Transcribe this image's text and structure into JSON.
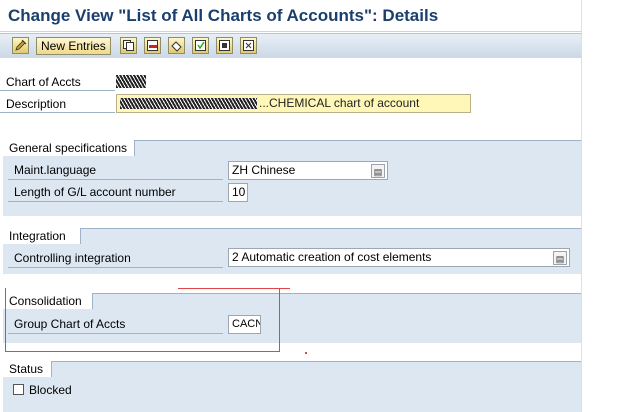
{
  "title": "Change View \"List of All Charts of Accounts\": Details",
  "toolbar": {
    "new_entries_label": "New Entries",
    "icons": [
      "edit-pencil-icon",
      "copy-icon",
      "delete-icon",
      "undo-icon",
      "select-all-icon",
      "select-block-icon",
      "deselect-all-icon"
    ]
  },
  "header": {
    "chart_of_accts_label": "Chart of Accts",
    "description_label": "Description",
    "description_value": "...CHEMICAL chart of account"
  },
  "general": {
    "title": "General specifications",
    "maint_language_label": "Maint.language",
    "maint_language_value": "ZH Chinese",
    "length_label": "Length of G/L account number",
    "length_value": "10"
  },
  "integration": {
    "title": "Integration",
    "controlling_label": "Controlling integration",
    "controlling_value": "2 Automatic creation of cost elements"
  },
  "consolidation": {
    "title": "Consolidation",
    "group_chart_label": "Group Chart of Accts",
    "group_chart_value": "CACN"
  },
  "status": {
    "title": "Status",
    "blocked_label": "Blocked"
  },
  "colors": {
    "title": "#1a3f6e",
    "group_bg": "#dde7f1",
    "required_field_bg": "#fff7b8",
    "highlight": "#e24545"
  }
}
